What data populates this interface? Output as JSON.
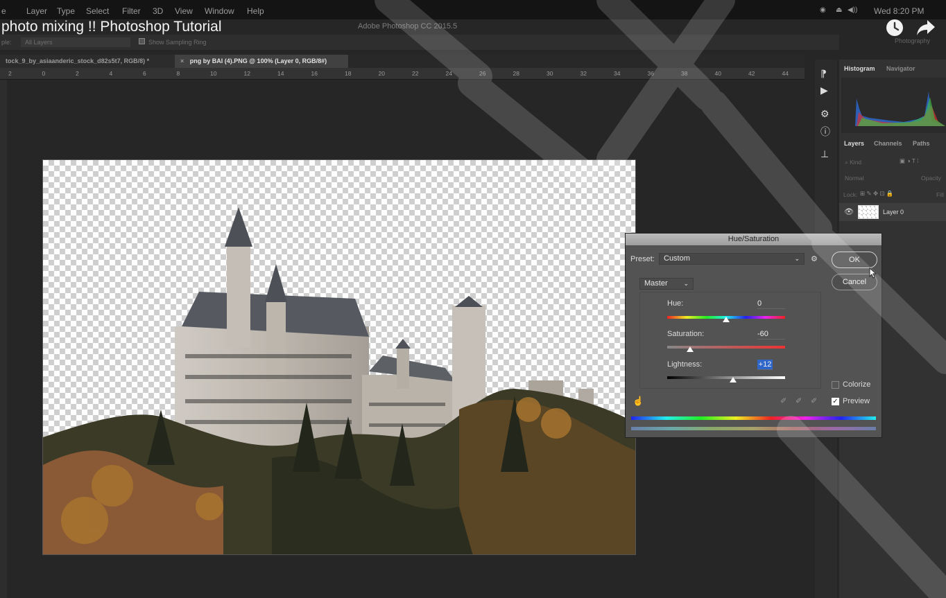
{
  "menubar": {
    "items": [
      "e",
      "Layer",
      "Type",
      "Select",
      "Filter",
      "3D",
      "View",
      "Window",
      "Help"
    ],
    "clock": "Wed 8:20 PM",
    "app_title": "Adobe Photoshop CC 2015.5"
  },
  "video": {
    "title": "photo mixing !! Photoshop Tutorial",
    "clock_icon": "clock-icon",
    "share_icon": "share-arrow-icon"
  },
  "options_bar": {
    "sample_label": "ple:",
    "sample_value": "All Layers",
    "show_ring": "Show Sampling Ring",
    "workspace": "Photography"
  },
  "tabs": [
    {
      "label": "tock_9_by_asiaanderic_stock_d82s5t7, RGB/8) *"
    },
    {
      "label": "png by BAI (4).PNG @ 100% (Layer 0, RGB/8#)"
    }
  ],
  "ruler": {
    "ticks": [
      "2",
      "0",
      "2",
      "4",
      "6",
      "8",
      "10",
      "12",
      "14",
      "16",
      "18",
      "20",
      "22",
      "24",
      "26",
      "28",
      "30",
      "32",
      "34",
      "36",
      "38",
      "40",
      "42",
      "44"
    ]
  },
  "right_panel": {
    "histogram_tab": "Histogram",
    "navigator_tab": "Navigator",
    "layers_tab": "Layers",
    "channels_tab": "Channels",
    "paths_tab": "Paths",
    "kind_placeholder": "Kind",
    "blend_mode": "Normal",
    "opacity_label": "Opacity",
    "lock_label": "Lock:",
    "fill_label": "Fill",
    "layer_name": "Layer 0"
  },
  "dialog": {
    "title": "Hue/Saturation",
    "preset_label": "Preset:",
    "preset_value": "Custom",
    "ok_label": "OK",
    "cancel_label": "Cancel",
    "channel_value": "Master",
    "hue_label": "Hue:",
    "hue_value": "0",
    "saturation_label": "Saturation:",
    "saturation_value": "-60",
    "lightness_label": "Lightness:",
    "lightness_value": "+12",
    "colorize_label": "Colorize",
    "preview_label": "Preview",
    "colorize_checked": false,
    "preview_checked": true
  }
}
